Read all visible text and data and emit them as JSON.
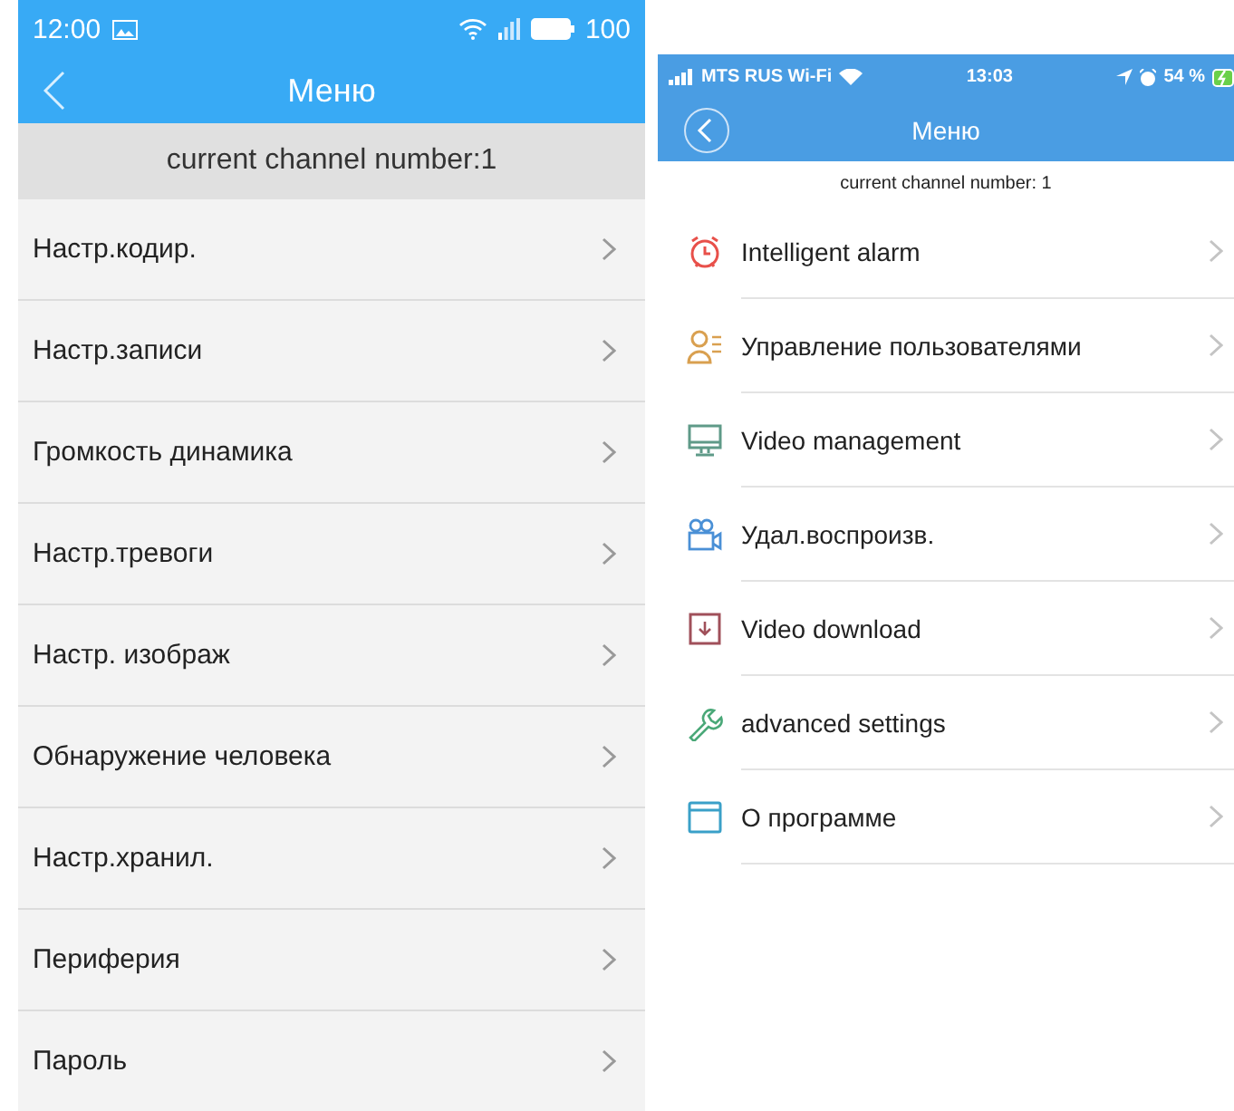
{
  "left_phone": {
    "status_bar": {
      "time": "12:00",
      "battery": "100"
    },
    "title": "Меню",
    "channel": "current channel number:1",
    "items": [
      {
        "label": "Настр.кодир."
      },
      {
        "label": "Настр.записи"
      },
      {
        "label": "Громкость динамика"
      },
      {
        "label": "Настр.тревоги"
      },
      {
        "label": "Настр. изображ"
      },
      {
        "label": "Обнаружение человека"
      },
      {
        "label": "Настр.хранил."
      },
      {
        "label": "Периферия"
      },
      {
        "label": "Пароль"
      }
    ]
  },
  "right_phone": {
    "status_bar": {
      "carrier": "MTS RUS Wi-Fi",
      "time": "13:03",
      "battery": "54 %"
    },
    "title": "Меню",
    "channel": "current channel number: 1",
    "items": [
      {
        "label": "Intelligent alarm",
        "kind": "alarm",
        "color": "#e8504a"
      },
      {
        "label": "Управление пользователями",
        "kind": "users",
        "color": "#d9a050"
      },
      {
        "label": "Video management",
        "kind": "monitor",
        "color": "#5f9a88"
      },
      {
        "label": "Удал.воспроизв.",
        "kind": "camera",
        "color": "#4a90d6"
      },
      {
        "label": "Video download",
        "kind": "download",
        "color": "#a0505a"
      },
      {
        "label": "advanced settings",
        "kind": "wrench",
        "color": "#4aa878"
      },
      {
        "label": "О программе",
        "kind": "window",
        "color": "#3aa0c8"
      }
    ]
  }
}
